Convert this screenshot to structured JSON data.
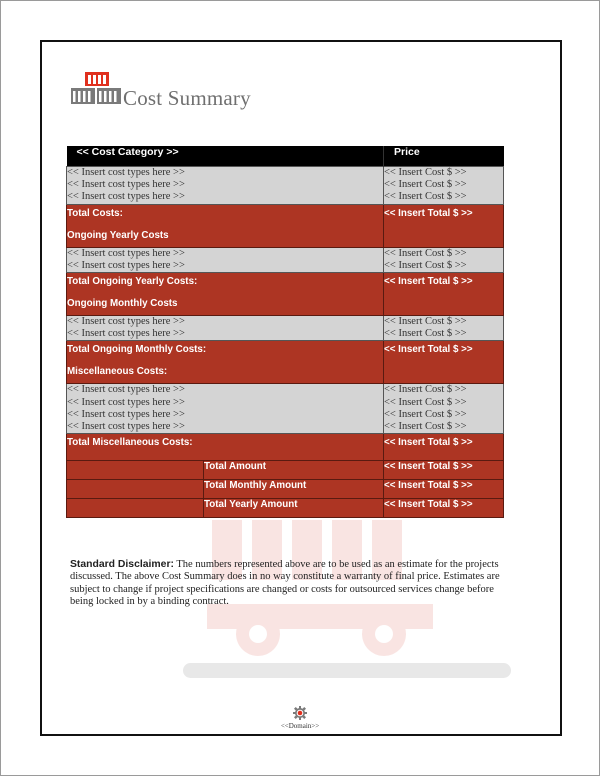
{
  "document": {
    "title": "Cost Summary",
    "logo_icon": "containers-stack-icon",
    "colors": {
      "accent_red": "#ad3523",
      "header_black": "#000000",
      "row_gray": "#d4d4d4",
      "title_gray": "#6f6f6f"
    }
  },
  "table": {
    "headers": {
      "category": "<< Cost Category >>",
      "price": "Price"
    },
    "sections": [
      {
        "items": [
          {
            "type": "<< Insert cost types here >>",
            "cost": "<< Insert Cost $ >>"
          },
          {
            "type": "<< Insert cost types here >>",
            "cost": "<< Insert Cost $ >>"
          },
          {
            "type": "<< Insert cost types here >>",
            "cost": "<< Insert Cost $ >>"
          }
        ],
        "total_label": "Total Costs:",
        "total_value": "<< Insert Total $ >>",
        "next_heading": "Ongoing Yearly Costs"
      },
      {
        "items": [
          {
            "type": "<< Insert cost types here >>",
            "cost": "<< Insert Cost $ >>"
          },
          {
            "type": "<< Insert cost types here >>",
            "cost": "<< Insert Cost $ >>"
          }
        ],
        "total_label": "Total Ongoing Yearly Costs:",
        "total_value": "<< Insert Total $ >>",
        "next_heading": "Ongoing Monthly Costs"
      },
      {
        "items": [
          {
            "type": "<< Insert cost types here >>",
            "cost": "<< Insert Cost $ >>"
          },
          {
            "type": "<< Insert cost types here >>",
            "cost": "<< Insert Cost $ >>"
          }
        ],
        "total_label": "Total Ongoing Monthly Costs:",
        "total_value": "<< Insert Total $ >>",
        "next_heading": "Miscellaneous Costs:"
      },
      {
        "items": [
          {
            "type": "<< Insert cost types here >>",
            "cost": "<< Insert Cost $ >>"
          },
          {
            "type": "<< Insert cost types here >>",
            "cost": "<< Insert Cost $ >>"
          },
          {
            "type": "<< Insert cost types here >>",
            "cost": "<< Insert Cost $ >>"
          },
          {
            "type": "<< Insert cost types here >>",
            "cost": "<< Insert Cost $ >>"
          }
        ],
        "total_label": "Total Miscellaneous Costs:",
        "total_value": "<< Insert Total $ >>",
        "next_heading": ""
      }
    ],
    "summary": [
      {
        "label": "Total Amount",
        "value": "<< Insert Total $ >>"
      },
      {
        "label": "Total Monthly Amount",
        "value": "<< Insert Total $ >>"
      },
      {
        "label": "Total Yearly Amount",
        "value": "<< Insert Total $ >>"
      }
    ]
  },
  "disclaimer": {
    "label": "Standard Disclaimer:",
    "text": " The numbers represented above are to be used as an estimate for the projects discussed. The above Cost Summary does in no way constitute a warranty of final price.  Estimates are subject to change if project specifications are changed or costs for outsourced services change before being locked in by a binding contract."
  },
  "footer": {
    "icon": "gear-icon",
    "text": "<<Domain>>"
  }
}
